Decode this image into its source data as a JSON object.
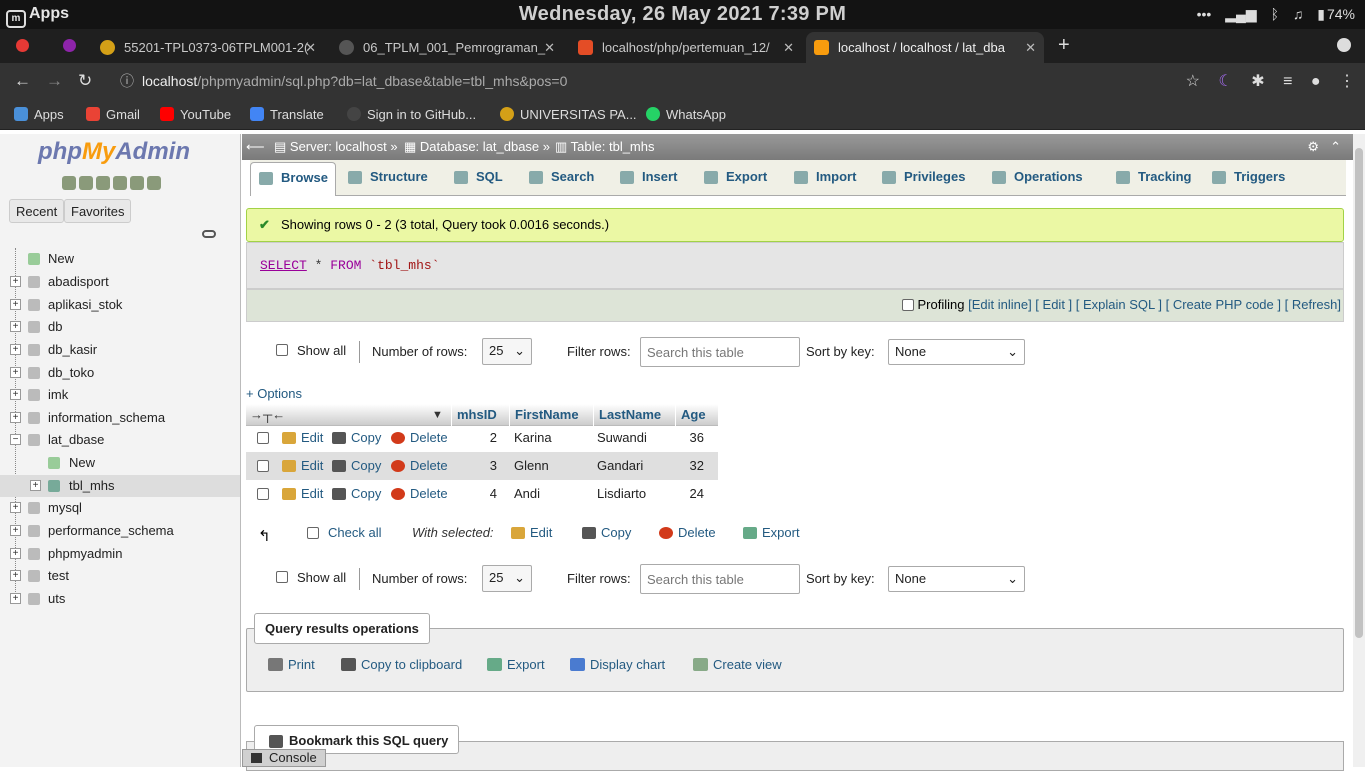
{
  "os": {
    "apps_label": "Apps",
    "clock": "Wednesday, 26 May 2021  7:39 PM",
    "battery": "74%"
  },
  "tabs": [
    {
      "label": "55201-TPL0373-06TPLM001-2(",
      "active": false
    },
    {
      "label": "06_TPLM_001_Pemrograman_",
      "active": false
    },
    {
      "label": "localhost/php/pertemuan_12/",
      "active": false
    },
    {
      "label": "localhost / localhost / lat_dba",
      "active": true
    }
  ],
  "address": {
    "host": "localhost",
    "path": "/phpmyadmin/sql.php?db=lat_dbase&table=tbl_mhs&pos=0"
  },
  "bookmarks": [
    "Apps",
    "Gmail",
    "YouTube",
    "Translate",
    "Sign in to GitHub...",
    "UNIVERSITAS PA...",
    "WhatsApp"
  ],
  "sidebar": {
    "logo_php": "php",
    "logo_my": "MyAdmin",
    "logo_admin": "Admin",
    "recent": "Recent",
    "favorites": "Favorites",
    "tree": [
      {
        "label": "New",
        "type": "new"
      },
      {
        "label": "abadisport",
        "type": "db"
      },
      {
        "label": "aplikasi_stok",
        "type": "db"
      },
      {
        "label": "db",
        "type": "db"
      },
      {
        "label": "db_kasir",
        "type": "db"
      },
      {
        "label": "db_toko",
        "type": "db"
      },
      {
        "label": "imk",
        "type": "db"
      },
      {
        "label": "information_schema",
        "type": "db"
      },
      {
        "label": "lat_dbase",
        "type": "db-open"
      },
      {
        "label": "New",
        "type": "subnew"
      },
      {
        "label": "tbl_mhs",
        "type": "table"
      },
      {
        "label": "mysql",
        "type": "db"
      },
      {
        "label": "performance_schema",
        "type": "db"
      },
      {
        "label": "phpmyadmin",
        "type": "db"
      },
      {
        "label": "test",
        "type": "db"
      },
      {
        "label": "uts",
        "type": "db"
      }
    ]
  },
  "breadcrumb": {
    "server": "Server: localhost",
    "database": "Database: lat_dbase",
    "table": "Table: tbl_mhs"
  },
  "main_tabs": [
    "Browse",
    "Structure",
    "SQL",
    "Search",
    "Insert",
    "Export",
    "Import",
    "Privileges",
    "Operations",
    "Tracking",
    "Triggers"
  ],
  "message": "Showing rows 0 - 2 (3 total, Query took 0.0016 seconds.)",
  "sql": {
    "select": "SELECT",
    "star": "*",
    "from": "FROM",
    "table": "`tbl_mhs`"
  },
  "sql_tools": {
    "profiling": "Profiling",
    "edit_inline": "Edit inline",
    "edit": "Edit",
    "explain": "Explain SQL",
    "php": "Create PHP code",
    "refresh": "Refresh"
  },
  "nav": {
    "show_all": "Show all",
    "num_rows_label": "Number of rows:",
    "num_rows": "25",
    "filter_label": "Filter rows:",
    "filter_placeholder": "Search this table",
    "sort_label": "Sort by key:",
    "sort_value": "None"
  },
  "options": "+ Options",
  "columns": [
    "mhsID",
    "FirstName",
    "LastName",
    "Age"
  ],
  "rows": [
    {
      "id": "2",
      "first": "Karina",
      "last": "Suwandi",
      "age": "36"
    },
    {
      "id": "3",
      "first": "Glenn",
      "last": "Gandari",
      "age": "32"
    },
    {
      "id": "4",
      "first": "Andi",
      "last": "Lisdiarto",
      "age": "24"
    }
  ],
  "row_actions": {
    "edit": "Edit",
    "copy": "Copy",
    "delete": "Delete"
  },
  "with_selected": {
    "check_all": "Check all",
    "label": "With selected:",
    "edit": "Edit",
    "copy": "Copy",
    "delete": "Delete",
    "export": "Export"
  },
  "qro": {
    "title": "Query results operations",
    "print": "Print",
    "clipboard": "Copy to clipboard",
    "export": "Export",
    "chart": "Display chart",
    "view": "Create view"
  },
  "bookmark": "Bookmark this SQL query",
  "console": "Console"
}
